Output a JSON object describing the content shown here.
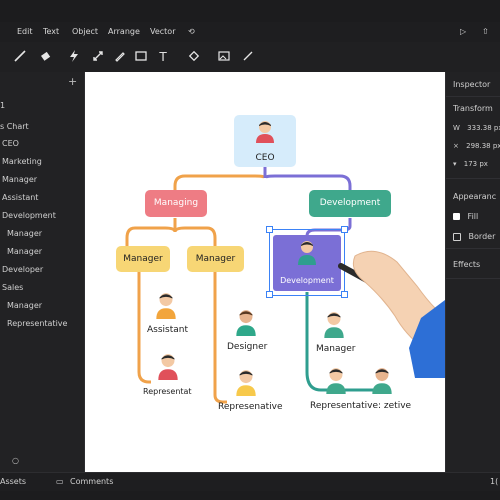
{
  "menu": {
    "items": [
      "Edit",
      "Text",
      "Object",
      "Arrange",
      "Vector"
    ]
  },
  "toolbar": {
    "icons": [
      "pen-tool-icon",
      "eraser-icon",
      "lightning-icon",
      "transform-icon",
      "pencil-icon",
      "rectangle-icon",
      "text-tool-icon",
      "diamond-icon",
      "image-icon",
      "line-icon"
    ]
  },
  "layers": {
    "header_fragment": "1",
    "items": [
      "s Chart",
      "CEO",
      "Marketing",
      "Manager",
      "Assistant",
      "Development",
      "Manager",
      "Manager",
      "Developer",
      "Sales",
      "Manager",
      "Representative"
    ]
  },
  "inspector": {
    "title": "Inspector",
    "transform_label": "Transform",
    "w_label": "W",
    "w_value": "333.38 px",
    "h_value": "298.38 px",
    "r_value": "173 px",
    "appearance_label": "Appearanc",
    "fill_label": "Fill",
    "border_label": "Border",
    "effects_label": "Effects"
  },
  "bottom": {
    "assets_label": "Assets",
    "comments_label": "Comments",
    "right_fragment": "1("
  },
  "chart": {
    "ceo": "CEO",
    "managing": "Managing",
    "development": "Development",
    "manager_left": "Manager",
    "manager_mid": "Manager",
    "dev_selected": "Development",
    "assistant": "Assistant",
    "designer": "Designer",
    "manager_right": "Manager",
    "representat": "Representat",
    "represenative": "Represenative",
    "rep_zetive": "Representative: zetive"
  },
  "colors": {
    "orange_line": "#f0a24a",
    "purple_line": "#7b6fd6",
    "teal_line": "#2f9e8f",
    "managing_fill": "#ee7c84",
    "development_fill": "#3fa88c",
    "manager_fill": "#f7d675",
    "ceo_fill": "#d6ecfb",
    "selection_blue": "#3b82f6"
  }
}
